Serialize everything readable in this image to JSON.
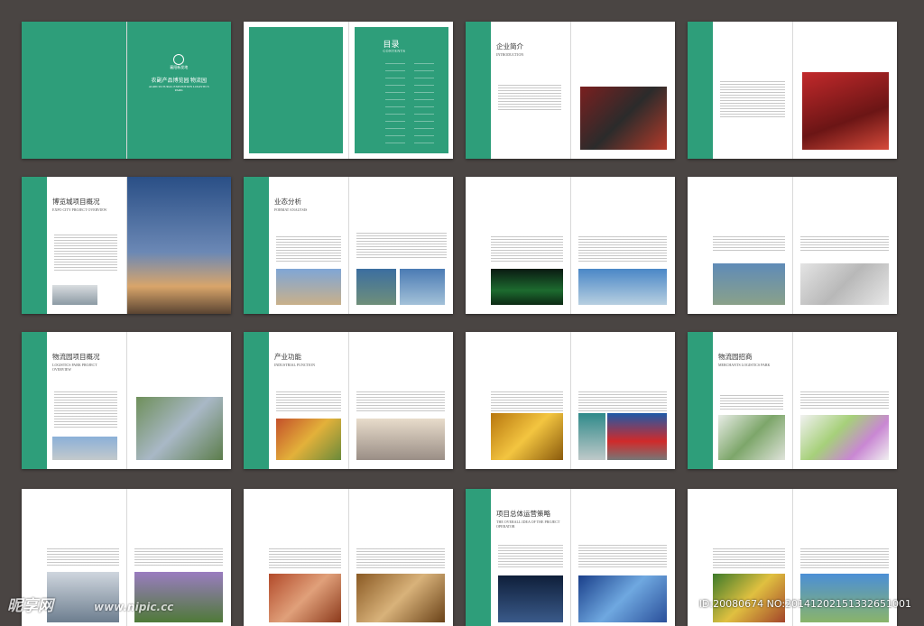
{
  "cover": {
    "title": "农副产品博览园 物流园",
    "subtitle_en": "AGRICULTURAL EXPOSITION LOGISTICS PARK",
    "brand": "襄阳新发地"
  },
  "toc": {
    "title": "目录",
    "title_en": "CONTENTS"
  },
  "spreads": [
    {
      "title": "企业简介",
      "sub": "INTRODUCTION"
    },
    {
      "title": "",
      "sub": ""
    },
    {
      "title": "博览城项目概况",
      "sub": "EXPO CITY PROJECT OVERVIEW"
    },
    {
      "title": "业态分析",
      "sub": "FORMAT ANALYSIS"
    },
    {
      "title": "",
      "sub": ""
    },
    {
      "title": "",
      "sub": ""
    },
    {
      "title": "物流园项目概况",
      "sub": "LOGISTICS PARK PROJECT OVERVIEW"
    },
    {
      "title": "产业功能",
      "sub": "INDUSTRIAL FUNCTION"
    },
    {
      "title": "",
      "sub": ""
    },
    {
      "title": "物流园招商",
      "sub": "MERCHANTS LOGISTICS PARK"
    },
    {
      "title": "",
      "sub": ""
    },
    {
      "title": "",
      "sub": ""
    },
    {
      "title": "项目总体运营策略",
      "sub": "THE OVERALL IDEA OF THE PROJECT OPERATOR"
    },
    {
      "title": "",
      "sub": ""
    }
  ],
  "watermark": {
    "logo": "昵享网",
    "url": "www.nipic.cc",
    "id": "ID:20080674 NO:20141202151332651001"
  },
  "colors": {
    "accent": "#2e9e7a",
    "background": "#4a4543"
  }
}
